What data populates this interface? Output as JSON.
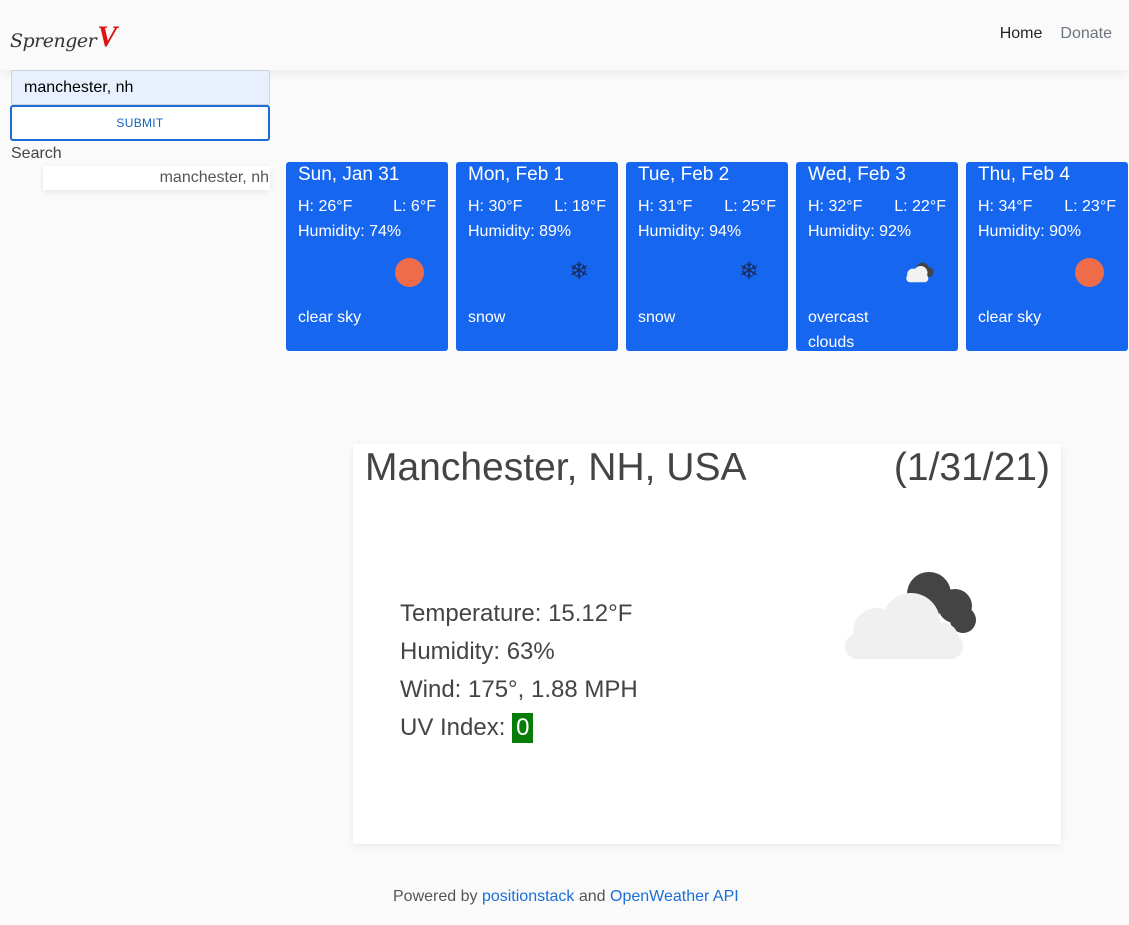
{
  "nav": {
    "brand_text": "Sprenger",
    "brand_mark": "V",
    "links": {
      "home": "Home",
      "donate": "Donate"
    }
  },
  "search": {
    "value": "manchester, nh",
    "submit_label": "SUBMIT",
    "history_label": "Search",
    "history": [
      "manchester, nh"
    ]
  },
  "forecast": [
    {
      "date": "Sun, Jan 31",
      "high": "H: 26°F",
      "low": "L: 6°F",
      "humidity": "Humidity: 74%",
      "icon": "sun-icon",
      "description": "clear sky"
    },
    {
      "date": "Mon, Feb 1",
      "high": "H: 30°F",
      "low": "L: 18°F",
      "humidity": "Humidity: 89%",
      "icon": "snowflake-icon",
      "description": "snow"
    },
    {
      "date": "Tue, Feb 2",
      "high": "H: 31°F",
      "low": "L: 25°F",
      "humidity": "Humidity: 94%",
      "icon": "snowflake-icon",
      "description": "snow"
    },
    {
      "date": "Wed, Feb 3",
      "high": "H: 32°F",
      "low": "L: 22°F",
      "humidity": "Humidity: 92%",
      "icon": "overcast-clouds-icon",
      "description": "overcast clouds"
    },
    {
      "date": "Thu, Feb 4",
      "high": "H: 34°F",
      "low": "L: 23°F",
      "humidity": "Humidity: 90%",
      "icon": "sun-icon",
      "description": "clear sky"
    }
  ],
  "current": {
    "city": "Manchester, NH, USA",
    "date": "(1/31/21)",
    "temperature": "Temperature: 15.12°F",
    "humidity": "Humidity: 63%",
    "wind": "Wind: 175°, 1.88 MPH",
    "uv_label": "UV Index: ",
    "uv_value": "0",
    "icon": "overcast-clouds-icon"
  },
  "footer": {
    "prefix": "Powered by ",
    "link1": "positionstack",
    "middle": " and ",
    "link2": "OpenWeather API"
  },
  "colors": {
    "card_blue": "#1766f0",
    "sun": "#ef6c4a",
    "uv_badge": "#087c08",
    "link": "#1a6fd6",
    "brand_mark": "#e01010"
  }
}
